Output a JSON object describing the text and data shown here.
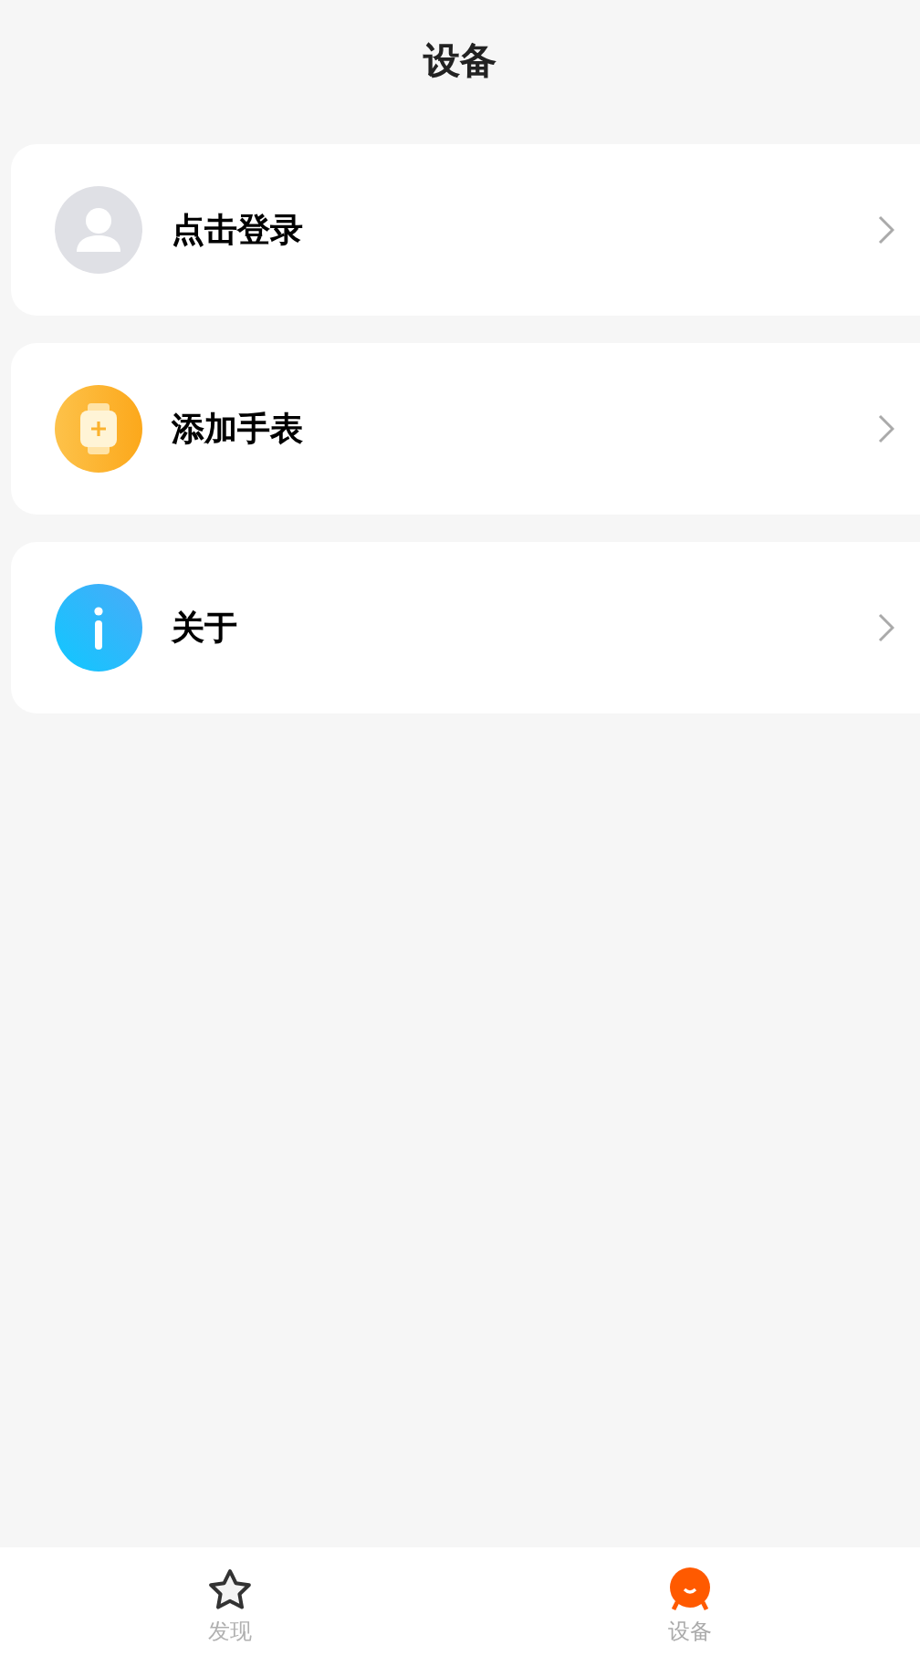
{
  "header": {
    "title": "设备"
  },
  "items": [
    {
      "kind": "user",
      "label": "点击登录"
    },
    {
      "kind": "watch",
      "label": "添加手表"
    },
    {
      "kind": "info",
      "label": "关于"
    }
  ],
  "tabs": [
    {
      "kind": "star",
      "label": "发现",
      "selected": false
    },
    {
      "kind": "mascot",
      "label": "设备",
      "selected": true
    }
  ]
}
